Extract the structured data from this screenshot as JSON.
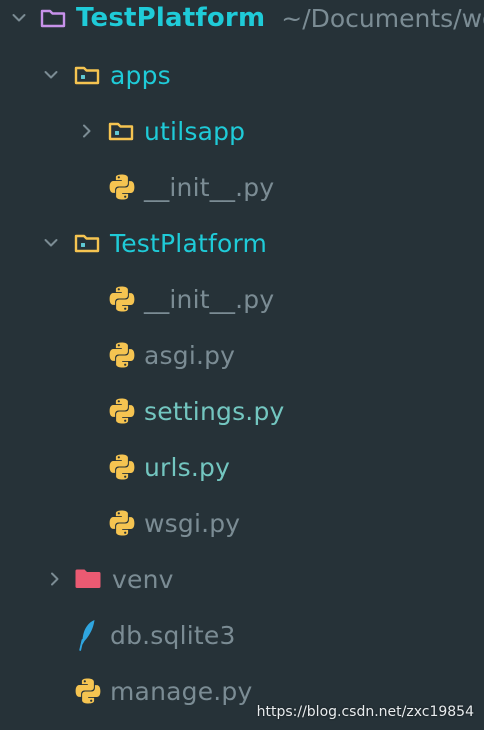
{
  "colors": {
    "background": "#263238",
    "folder_text": "#1fcbd8",
    "file_text": "#7b8c94",
    "file_text_highlight": "#73c6c0",
    "folder_icon": "#f5c451",
    "root_folder_icon": "#c792ea",
    "venv_folder_icon": "#ea5a72"
  },
  "tree": {
    "root": {
      "label": "TestPlatform",
      "path": "~/Documents/wo",
      "icon": "folder-open-icon"
    },
    "items": [
      {
        "label": "apps",
        "type": "folder",
        "expanded": true,
        "icon": "folder-module-icon"
      },
      {
        "label": "utilsapp",
        "type": "folder",
        "expanded": false,
        "icon": "folder-module-icon"
      },
      {
        "label": "__init__.py",
        "type": "file",
        "icon": "python-icon"
      },
      {
        "label": "TestPlatform",
        "type": "folder",
        "expanded": true,
        "icon": "folder-module-icon"
      },
      {
        "label": "__init__.py",
        "type": "file",
        "icon": "python-icon"
      },
      {
        "label": "asgi.py",
        "type": "file",
        "icon": "python-icon"
      },
      {
        "label": "settings.py",
        "type": "file",
        "icon": "python-icon"
      },
      {
        "label": "urls.py",
        "type": "file",
        "icon": "python-icon"
      },
      {
        "label": "wsgi.py",
        "type": "file",
        "icon": "python-icon"
      },
      {
        "label": "venv",
        "type": "folder",
        "expanded": false,
        "icon": "folder-venv-icon"
      },
      {
        "label": "db.sqlite3",
        "type": "file",
        "icon": "sqlite-feather-icon"
      },
      {
        "label": "manage.py",
        "type": "file",
        "icon": "python-icon"
      }
    ]
  },
  "watermark": "https://blog.csdn.net/zxc19854"
}
